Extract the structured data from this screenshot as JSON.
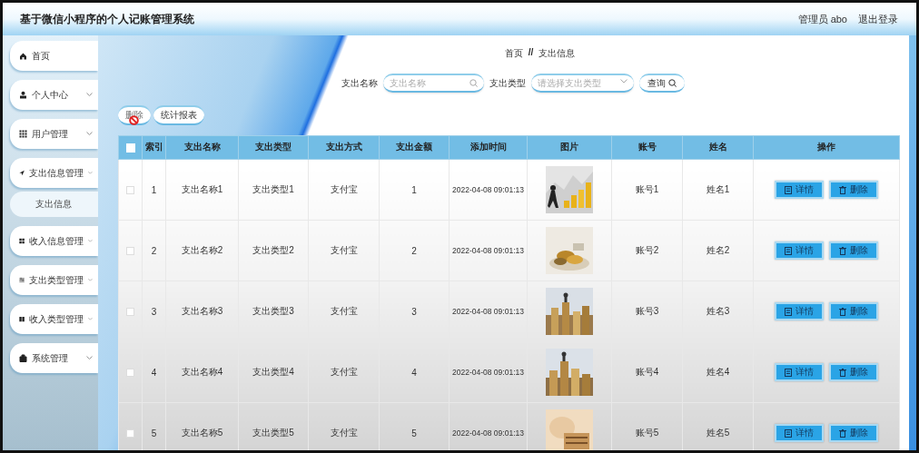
{
  "header": {
    "title": "基于微信小程序的个人记账管理系统",
    "user": "管理员 abo",
    "logout": "退出登录"
  },
  "sidebar": {
    "items": [
      {
        "label": "首页",
        "kind": "link"
      },
      {
        "label": "个人中心",
        "kind": "menu"
      },
      {
        "label": "用户管理",
        "kind": "menu"
      },
      {
        "label": "支出信息管理",
        "kind": "menu",
        "children": [
          {
            "label": "支出信息",
            "selected": true
          }
        ]
      },
      {
        "label": "收入信息管理",
        "kind": "menu"
      },
      {
        "label": "支出类型管理",
        "kind": "menu"
      },
      {
        "label": "收入类型管理",
        "kind": "menu"
      },
      {
        "label": "系统管理",
        "kind": "menu"
      }
    ]
  },
  "breadcrumb": {
    "items": [
      "首页",
      "支出信息"
    ],
    "separator": "//"
  },
  "search": {
    "fields": [
      {
        "label": "支出名称",
        "placeholder": "支出名称",
        "kind": "text"
      },
      {
        "label": "支出类型",
        "placeholder": "请选择支出类型",
        "kind": "select"
      }
    ],
    "button": "查询"
  },
  "toolbar": [
    {
      "label": "删除",
      "disabled": true
    },
    {
      "label": "统计报表",
      "disabled": false
    }
  ],
  "table": {
    "select_all": false,
    "columns": [
      "索引",
      "支出名称",
      "支出类型",
      "支出方式",
      "支出金额",
      "添加时间",
      "图片",
      "账号",
      "姓名",
      "操作"
    ],
    "rows": [
      {
        "checked": false,
        "index": "1",
        "name": "支出名称1",
        "type": "支出类型1",
        "method": "支付宝",
        "amount": "1",
        "time": "2022-04-08 09:01:13",
        "account": "账号1",
        "person": "姓名1",
        "actions": [
          "详情",
          "删除"
        ]
      },
      {
        "checked": false,
        "index": "2",
        "name": "支出名称2",
        "type": "支出类型2",
        "method": "支付宝",
        "amount": "2",
        "time": "2022-04-08 09:01:13",
        "account": "账号2",
        "person": "姓名2",
        "actions": [
          "详情",
          "删除"
        ]
      },
      {
        "checked": false,
        "index": "3",
        "name": "支出名称3",
        "type": "支出类型3",
        "method": "支付宝",
        "amount": "3",
        "time": "2022-04-08 09:01:13",
        "account": "账号3",
        "person": "姓名3",
        "actions": [
          "详情",
          "删除"
        ]
      },
      {
        "checked": false,
        "index": "4",
        "name": "支出名称4",
        "type": "支出类型4",
        "method": "支付宝",
        "amount": "4",
        "time": "2022-04-08 09:01:13",
        "account": "账号4",
        "person": "姓名4",
        "actions": [
          "详情",
          "删除"
        ]
      },
      {
        "checked": false,
        "index": "5",
        "name": "支出名称5",
        "type": "支出类型5",
        "method": "支付宝",
        "amount": "5",
        "time": "2022-04-08 09:01:13",
        "account": "账号5",
        "person": "姓名5",
        "actions": [
          "详情",
          "删除"
        ]
      }
    ]
  }
}
